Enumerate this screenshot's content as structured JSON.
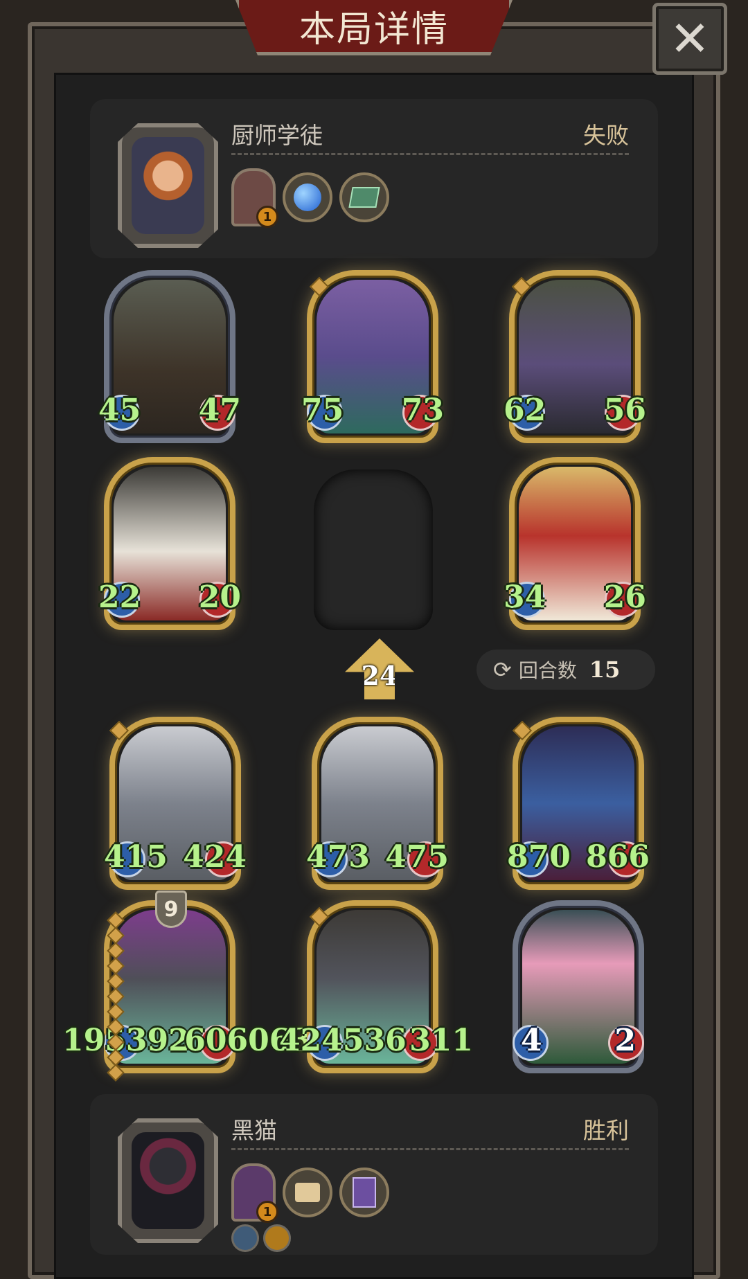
{
  "title": "本局详情",
  "close_label": "✕",
  "player_top": {
    "name": "厨师学徒",
    "result": "失败",
    "equip_badge": "1",
    "items": [
      "blue-orb-icon",
      "spellbook-icon"
    ]
  },
  "player_bottom": {
    "name": "黑猫",
    "result": "胜利",
    "equip_badge": "1",
    "items": [
      "scroll-icon",
      "purple-spellbook-icon"
    ],
    "buffs": [
      "sword-shield-icon",
      "muscle-icon"
    ]
  },
  "top_board": [
    {
      "attack": "45",
      "health": "47"
    },
    {
      "attack": "75",
      "health": "73"
    },
    {
      "attack": "62",
      "health": "56"
    },
    {
      "attack": "22",
      "health": "20"
    },
    {
      "attack": "34",
      "health": "26"
    }
  ],
  "level_marker": "24",
  "round": {
    "label": "回合数",
    "value": "15"
  },
  "bottom_board": [
    {
      "attack": "415",
      "health": "424"
    },
    {
      "attack": "473",
      "health": "475"
    },
    {
      "attack": "870",
      "health": "866"
    },
    {
      "attack": "195392",
      "health": "606063"
    },
    {
      "attack": "424536",
      "health": "311"
    },
    {
      "attack": "4",
      "health": "2"
    }
  ],
  "shield_value": "9",
  "colors": {
    "banner": "#6b1b17",
    "gold_frame": "#c9a24a",
    "stat_text": "#b6f28c",
    "panel_bg": "#262626"
  }
}
